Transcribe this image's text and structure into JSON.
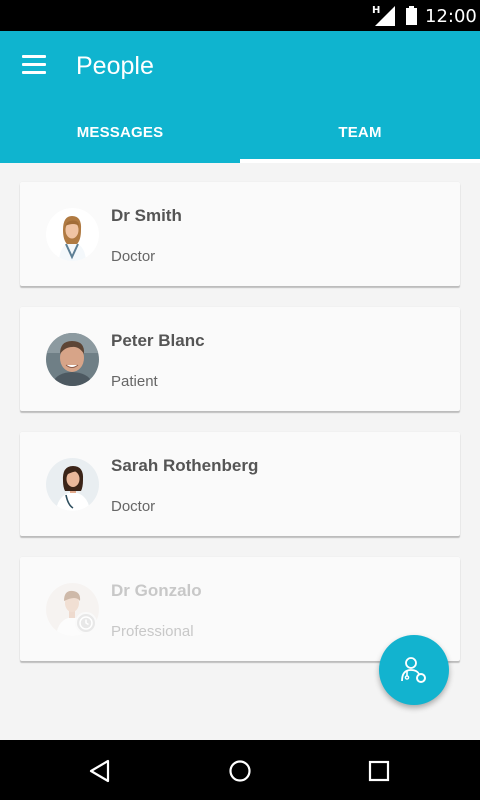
{
  "status_bar": {
    "network": "H",
    "time": "12:00",
    "icons": [
      "signal-icon",
      "battery-icon"
    ]
  },
  "app_bar": {
    "title": "People",
    "menu_icon": "menu-icon",
    "color": "#0fb4cf"
  },
  "tabs": [
    {
      "label": "MESSAGES",
      "active": false
    },
    {
      "label": "TEAM",
      "active": true
    }
  ],
  "people": [
    {
      "name": "Dr Smith",
      "role": "Doctor",
      "pending": false
    },
    {
      "name": "Peter Blanc",
      "role": "Patient",
      "pending": false
    },
    {
      "name": "Sarah Rothenberg",
      "role": "Doctor",
      "pending": false
    },
    {
      "name": "Dr Gonzalo",
      "role": "Professional",
      "pending": true
    }
  ],
  "fab": {
    "icon": "add-professional-icon"
  },
  "nav_bar": {
    "icons": [
      "back-icon",
      "home-icon",
      "recents-icon"
    ]
  }
}
